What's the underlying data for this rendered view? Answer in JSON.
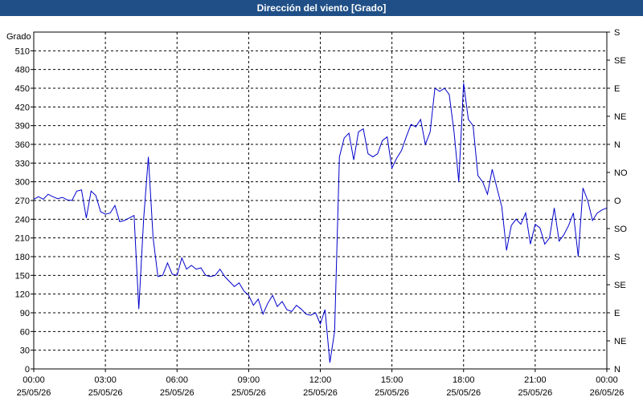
{
  "window": {
    "title": "Dirección del viento [Grado]"
  },
  "chart_data": {
    "type": "line",
    "title": "Dirección del viento [Grado]",
    "ylabel": "Grado",
    "ylim": [
      0,
      540
    ],
    "y_ticks": [
      0,
      30,
      60,
      90,
      120,
      150,
      180,
      210,
      240,
      270,
      300,
      330,
      360,
      390,
      420,
      450,
      480,
      510
    ],
    "y2_ticks": [
      {
        "value": 0,
        "label": "N"
      },
      {
        "value": 45,
        "label": "NE"
      },
      {
        "value": 90,
        "label": "E"
      },
      {
        "value": 135,
        "label": "SE"
      },
      {
        "value": 180,
        "label": "S"
      },
      {
        "value": 225,
        "label": "SO"
      },
      {
        "value": 270,
        "label": "O"
      },
      {
        "value": 315,
        "label": "NO"
      },
      {
        "value": 360,
        "label": "N"
      },
      {
        "value": 405,
        "label": "NE"
      },
      {
        "value": 450,
        "label": "E"
      },
      {
        "value": 495,
        "label": "SE"
      },
      {
        "value": 540,
        "label": "S"
      }
    ],
    "xlim_hours": [
      0,
      24
    ],
    "x_ticks": [
      {
        "hour": 0,
        "time": "00:00",
        "date": "25/05/26"
      },
      {
        "hour": 3,
        "time": "03:00",
        "date": "25/05/26"
      },
      {
        "hour": 6,
        "time": "06:00",
        "date": "25/05/26"
      },
      {
        "hour": 9,
        "time": "09:00",
        "date": "25/05/26"
      },
      {
        "hour": 12,
        "time": "12:00",
        "date": "25/05/26"
      },
      {
        "hour": 15,
        "time": "15:00",
        "date": "25/05/26"
      },
      {
        "hour": 18,
        "time": "18:00",
        "date": "25/05/26"
      },
      {
        "hour": 21,
        "time": "21:00",
        "date": "25/05/26"
      },
      {
        "hour": 24,
        "time": "00:00",
        "date": "26/05/26"
      }
    ],
    "grid": true,
    "line_color": "#0000cc",
    "series": [
      {
        "x": [
          0,
          0.2,
          0.4,
          0.6,
          0.8,
          1.0,
          1.2,
          1.4,
          1.6,
          1.8,
          2.0,
          2.2,
          2.4,
          2.6,
          2.8,
          3.0,
          3.2,
          3.4,
          3.6,
          3.8,
          4.0,
          4.2,
          4.4,
          4.6,
          4.8,
          5.0,
          5.2,
          5.4,
          5.6,
          5.8,
          6.0,
          6.2,
          6.4,
          6.6,
          6.8,
          7.0,
          7.2,
          7.4,
          7.6,
          7.8,
          8.0,
          8.2,
          8.4,
          8.6,
          8.8,
          9.0,
          9.2,
          9.4,
          9.6,
          9.8,
          10.0,
          10.2,
          10.4,
          10.6,
          10.8,
          11.0,
          11.2,
          11.4,
          11.6,
          11.8,
          12.0,
          12.2,
          12.4,
          12.6,
          12.8,
          13.0,
          13.2,
          13.4,
          13.6,
          13.8,
          14.0,
          14.2,
          14.4,
          14.6,
          14.8,
          15.0,
          15.2,
          15.4,
          15.6,
          15.8,
          16.0,
          16.2,
          16.4,
          16.6,
          16.8,
          17.0,
          17.2,
          17.4,
          17.6,
          17.8,
          18.0,
          18.2,
          18.4,
          18.6,
          18.8,
          19.0,
          19.2,
          19.4,
          19.6,
          19.8,
          20.0,
          20.2,
          20.4,
          20.6,
          20.8,
          21.0,
          21.2,
          21.4,
          21.6,
          21.8,
          22.0,
          22.2,
          22.4,
          22.6,
          22.8,
          23.0,
          23.2,
          23.4,
          23.6,
          23.8,
          24.0
        ],
        "y": [
          272,
          276,
          272,
          280,
          276,
          273,
          275,
          271,
          270,
          285,
          287,
          242,
          285,
          278,
          252,
          248,
          250,
          262,
          236,
          238,
          242,
          246,
          96,
          240,
          340,
          210,
          148,
          150,
          170,
          152,
          150,
          178,
          160,
          166,
          160,
          162,
          150,
          148,
          150,
          160,
          148,
          140,
          132,
          138,
          125,
          118,
          102,
          112,
          88,
          105,
          118,
          100,
          108,
          95,
          92,
          102,
          96,
          88,
          86,
          90,
          72,
          95,
          10,
          60,
          340,
          370,
          378,
          335,
          380,
          385,
          345,
          340,
          345,
          366,
          372,
          322,
          338,
          350,
          372,
          392,
          388,
          400,
          360,
          380,
          450,
          445,
          450,
          440,
          380,
          300,
          458,
          400,
          390,
          310,
          300,
          280,
          320,
          290,
          260,
          190,
          230,
          240,
          232,
          250,
          200,
          232,
          226,
          200,
          210,
          258,
          205,
          215,
          230,
          250,
          180,
          290,
          270,
          238,
          250,
          255,
          258
        ]
      }
    ]
  }
}
